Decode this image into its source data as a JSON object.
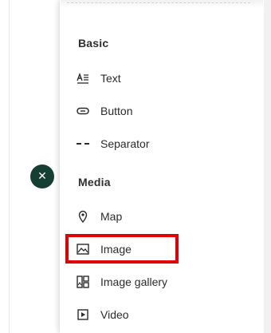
{
  "panel": {
    "sections": [
      {
        "title": "Basic",
        "items": [
          {
            "label": "Text",
            "icon": "text-format-icon"
          },
          {
            "label": "Button",
            "icon": "button-icon"
          },
          {
            "label": "Separator",
            "icon": "separator-icon"
          }
        ]
      },
      {
        "title": "Media",
        "items": [
          {
            "label": "Map",
            "icon": "map-pin-icon"
          },
          {
            "label": "Image",
            "icon": "image-icon"
          },
          {
            "label": "Image gallery",
            "icon": "image-gallery-icon"
          },
          {
            "label": "Video",
            "icon": "video-play-icon"
          }
        ]
      }
    ]
  },
  "close_button": {
    "glyph": "✕",
    "icon": "close-icon"
  },
  "highlight": {
    "target": "Image",
    "color": "#e00000"
  },
  "colors": {
    "close_bg": "#163f33",
    "text": "#2b2b2b"
  }
}
